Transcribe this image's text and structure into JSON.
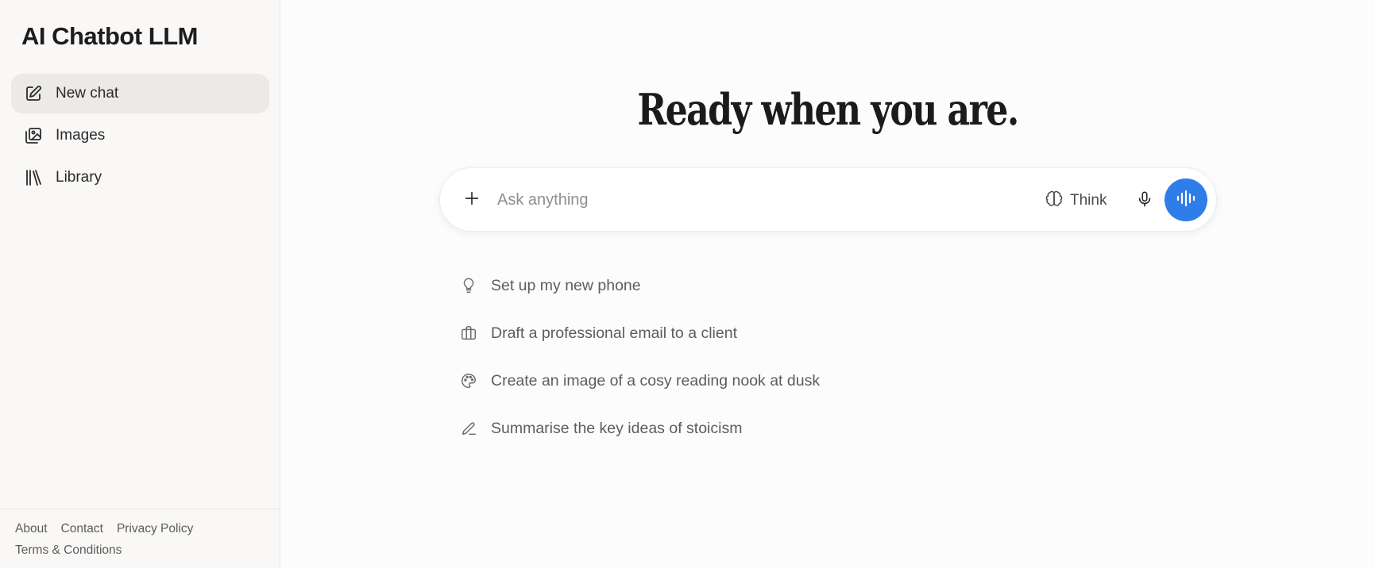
{
  "app": {
    "title": "AI Chatbot LLM"
  },
  "sidebar": {
    "items": [
      {
        "label": "New chat",
        "icon": "edit-square-icon"
      },
      {
        "label": "Images",
        "icon": "image-stack-icon"
      },
      {
        "label": "Library",
        "icon": "books-icon"
      }
    ]
  },
  "footer": {
    "links": [
      "About",
      "Contact",
      "Privacy Policy",
      "Terms & Conditions"
    ]
  },
  "main": {
    "headline": "Ready when you are.",
    "composer": {
      "placeholder": "Ask anything",
      "think_label": "Think",
      "accent": "#2f7de9"
    },
    "suggestions": [
      {
        "label": "Set up my new phone",
        "icon": "lightbulb-icon"
      },
      {
        "label": "Draft a professional email to a client",
        "icon": "briefcase-icon"
      },
      {
        "label": "Create an image of a cosy reading nook at dusk",
        "icon": "palette-icon"
      },
      {
        "label": "Summarise the key ideas of stoicism",
        "icon": "pencil-icon"
      }
    ]
  }
}
